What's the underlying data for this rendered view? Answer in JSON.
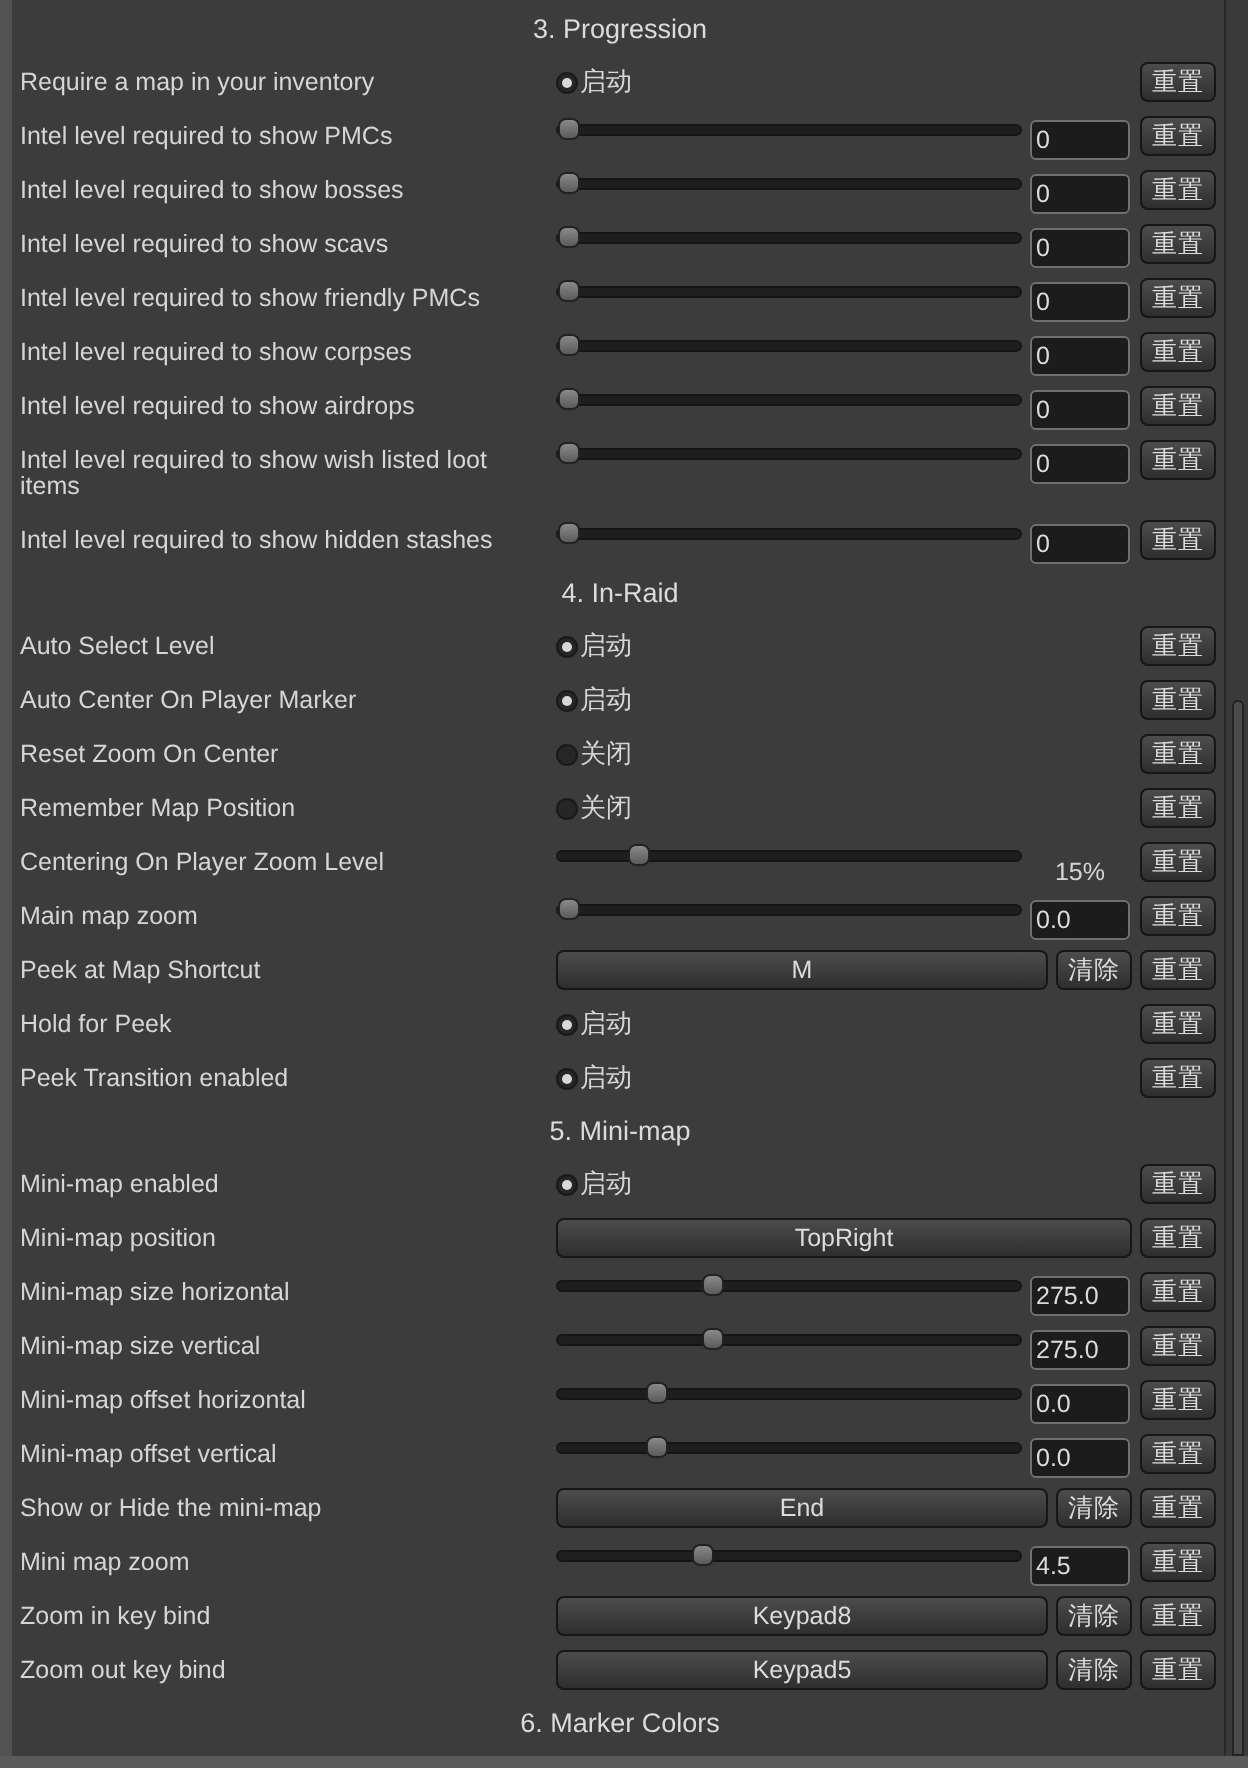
{
  "sections": [
    {
      "title": "3. Progression",
      "rows": [
        {
          "label": "Require a map in your inventory",
          "kind": "toggle",
          "on": true,
          "text": "启动",
          "reset": "重置"
        },
        {
          "label": "Intel level required to show PMCs",
          "kind": "slider",
          "level": 0,
          "value": "0",
          "reset": "重置"
        },
        {
          "label": "Intel level required to show bosses",
          "kind": "slider",
          "level": 0,
          "value": "0",
          "reset": "重置"
        },
        {
          "label": "Intel level required to show scavs",
          "kind": "slider",
          "level": 0,
          "value": "0",
          "reset": "重置"
        },
        {
          "label": "Intel level required to show friendly PMCs",
          "kind": "slider",
          "level": 0,
          "value": "0",
          "reset": "重置"
        },
        {
          "label": "Intel level required to show corpses",
          "kind": "slider",
          "level": 0,
          "value": "0",
          "reset": "重置"
        },
        {
          "label": "Intel level required to show airdrops",
          "kind": "slider",
          "level": 0,
          "value": "0",
          "reset": "重置"
        },
        {
          "label": "Intel level required to show wish listed loot items",
          "kind": "slider",
          "level": 0,
          "value": "0",
          "reset": "重置"
        },
        {
          "label": "Intel level required to show hidden stashes",
          "kind": "slider",
          "level": 0,
          "value": "0",
          "reset": "重置"
        }
      ]
    },
    {
      "title": "4. In-Raid",
      "rows": [
        {
          "label": "Auto Select Level",
          "kind": "toggle",
          "on": true,
          "text": "启动",
          "reset": "重置"
        },
        {
          "label": "Auto Center On Player Marker",
          "kind": "toggle",
          "on": true,
          "text": "启动",
          "reset": "重置"
        },
        {
          "label": "Reset Zoom On Center",
          "kind": "toggle",
          "on": false,
          "text": "关闭",
          "reset": "重置"
        },
        {
          "label": "Remember Map Position",
          "kind": "toggle",
          "on": false,
          "text": "关闭",
          "reset": "重置"
        },
        {
          "label": "Centering On Player Zoom Level",
          "kind": "percent",
          "level": 0.15,
          "reading": "15%",
          "reset": "重置"
        },
        {
          "label": "Main map zoom",
          "kind": "slider",
          "level": 0,
          "value": "0.0",
          "reset": "重置"
        },
        {
          "label": "Peek at Map Shortcut",
          "kind": "keybind",
          "key": "M",
          "clear": "清除",
          "reset": "重置"
        },
        {
          "label": "Hold for Peek",
          "kind": "toggle",
          "on": true,
          "text": "启动",
          "reset": "重置"
        },
        {
          "label": "Peek Transition enabled",
          "kind": "toggle",
          "on": true,
          "text": "启动",
          "reset": "重置"
        }
      ]
    },
    {
      "title": "5. Mini-map",
      "rows": [
        {
          "label": "Mini-map enabled",
          "kind": "toggle",
          "on": true,
          "text": "启动",
          "reset": "重置"
        },
        {
          "label": "Mini-map position",
          "kind": "dropdown",
          "value": "TopRight",
          "reset": "重置"
        },
        {
          "label": "Mini-map size horizontal",
          "kind": "slider",
          "level": 0.31,
          "value": "275.0",
          "reset": "重置"
        },
        {
          "label": "Mini-map size vertical",
          "kind": "slider",
          "level": 0.31,
          "value": "275.0",
          "reset": "重置"
        },
        {
          "label": "Mini-map offset horizontal",
          "kind": "slider",
          "level": 0.19,
          "value": "0.0",
          "reset": "重置"
        },
        {
          "label": "Mini-map offset vertical",
          "kind": "slider",
          "level": 0.19,
          "value": "0.0",
          "reset": "重置"
        },
        {
          "label": "Show or Hide the mini-map",
          "kind": "keybind",
          "key": "End",
          "clear": "清除",
          "reset": "重置"
        },
        {
          "label": "Mini map zoom",
          "kind": "slider",
          "level": 0.29,
          "value": "4.5",
          "reset": "重置"
        },
        {
          "label": "Zoom in key bind",
          "kind": "keybind",
          "key": "Keypad8",
          "clear": "清除",
          "reset": "重置"
        },
        {
          "label": "Zoom out key bind",
          "kind": "keybind",
          "key": "Keypad5",
          "clear": "清除",
          "reset": "重置"
        }
      ]
    },
    {
      "title": "6. Marker Colors"
    }
  ]
}
